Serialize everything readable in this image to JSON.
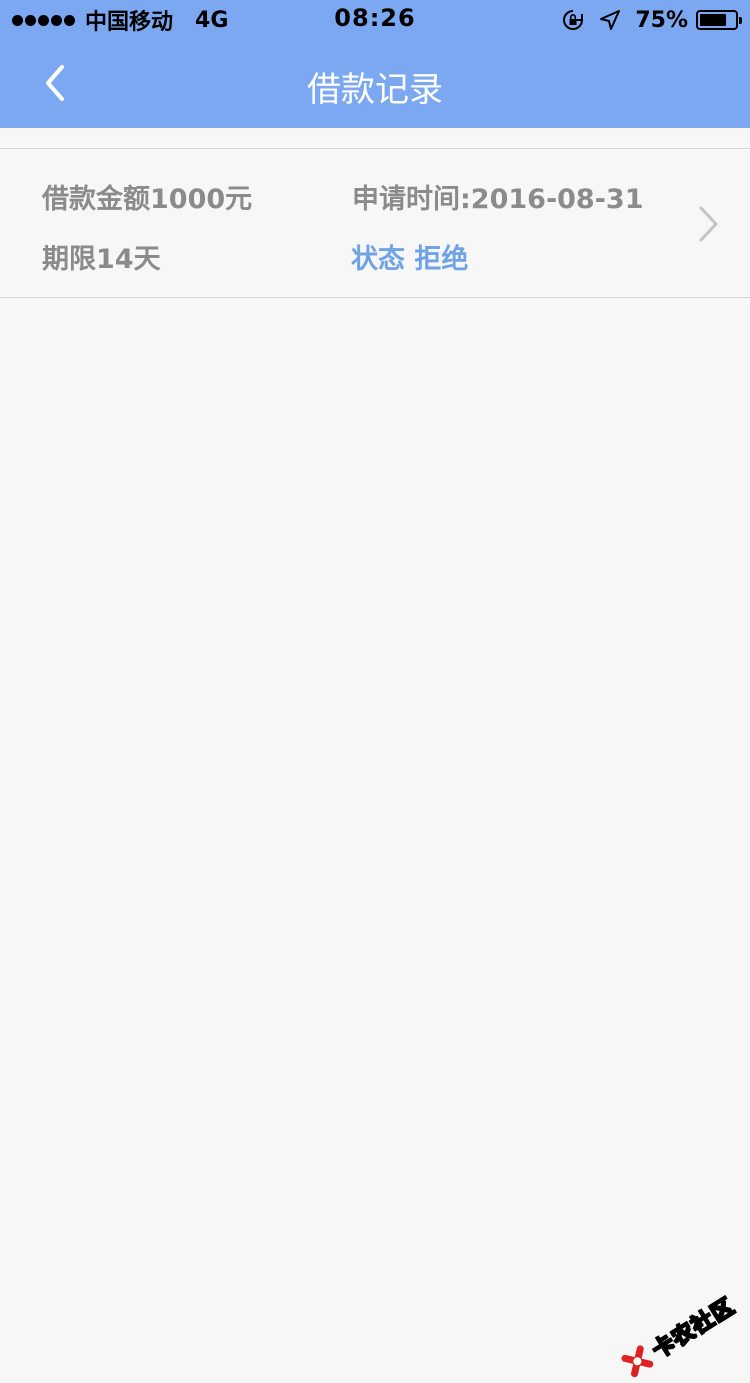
{
  "status_bar": {
    "carrier": "中国移动",
    "network": "4G",
    "time": "08:26",
    "battery_percent": "75%",
    "battery_level": 0.75,
    "icons": [
      "rotation-lock-icon",
      "location-arrow-icon"
    ]
  },
  "nav": {
    "title": "借款记录",
    "back_icon": "chevron-left-icon"
  },
  "records": [
    {
      "amount": "借款金额1000元",
      "apply_time": "申请时间:2016-08-31",
      "term": "期限14天",
      "status": "状态 拒绝"
    }
  ],
  "watermark": {
    "text": "卡农社区"
  },
  "colors": {
    "header_bg": "#7ba8f0",
    "page_bg": "#f7f7f7",
    "text_gray": "#8b8b8b",
    "status_blue": "#6fa3e6"
  }
}
